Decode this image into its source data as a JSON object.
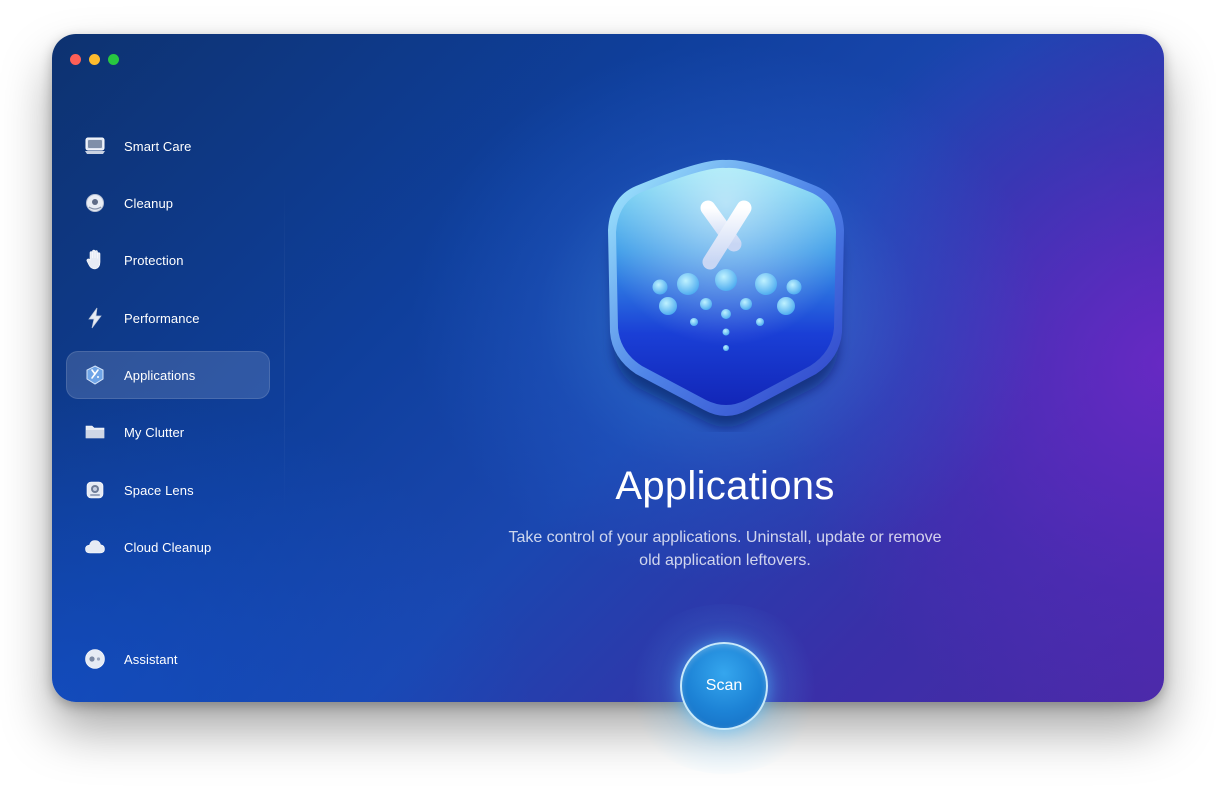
{
  "sidebar": {
    "items": [
      {
        "label": "Smart Care",
        "icon": "monitor-icon"
      },
      {
        "label": "Cleanup",
        "icon": "cleanup-disc-icon"
      },
      {
        "label": "Protection",
        "icon": "hand-icon"
      },
      {
        "label": "Performance",
        "icon": "lightning-icon"
      },
      {
        "label": "Applications",
        "icon": "applications-icon",
        "active": true
      },
      {
        "label": "My Clutter",
        "icon": "folder-icon"
      },
      {
        "label": "Space Lens",
        "icon": "lens-icon"
      },
      {
        "label": "Cloud Cleanup",
        "icon": "cloud-icon"
      }
    ],
    "assistant": {
      "label": "Assistant",
      "icon": "assistant-icon"
    }
  },
  "main": {
    "title": "Applications",
    "subtitle": "Take control of your applications. Uninstall, update or remove old application leftovers.",
    "scan_label": "Scan"
  },
  "colors": {
    "accent": "#1d83d6",
    "background": "#1a47b0",
    "purple": "#4a2aa6"
  }
}
